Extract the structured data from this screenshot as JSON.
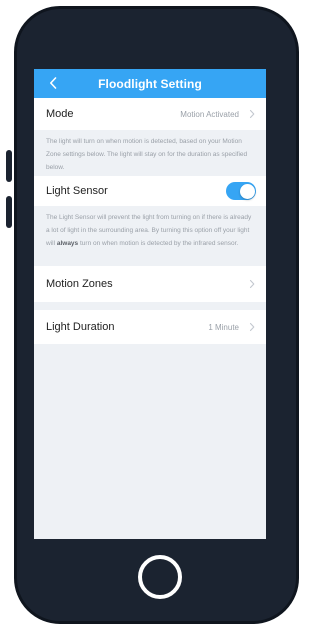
{
  "navbar": {
    "title": "Floodlight Setting",
    "back_icon": "chevron-left-icon",
    "color": "#36a5f4"
  },
  "mode": {
    "label": "Mode",
    "value": "Motion Activated",
    "description": "The light will turn on when motion is detected, based on your Motion Zone settings below. The light will stay on for the duration as specified below."
  },
  "light_sensor": {
    "label": "Light Sensor",
    "enabled": true,
    "description_before": "The Light Sensor will prevent the light from turning on if there is already a lot of light in the surrounding area. By turning this option off your light will ",
    "description_bold": "always",
    "description_after": " turn on when motion is detected by the infrared sensor."
  },
  "motion_zones": {
    "label": "Motion Zones"
  },
  "light_duration": {
    "label": "Light Duration",
    "value": "1 Minute"
  },
  "colors": {
    "accent": "#36a5f4",
    "background": "#eef1f5",
    "phone_body": "#1b2330"
  }
}
